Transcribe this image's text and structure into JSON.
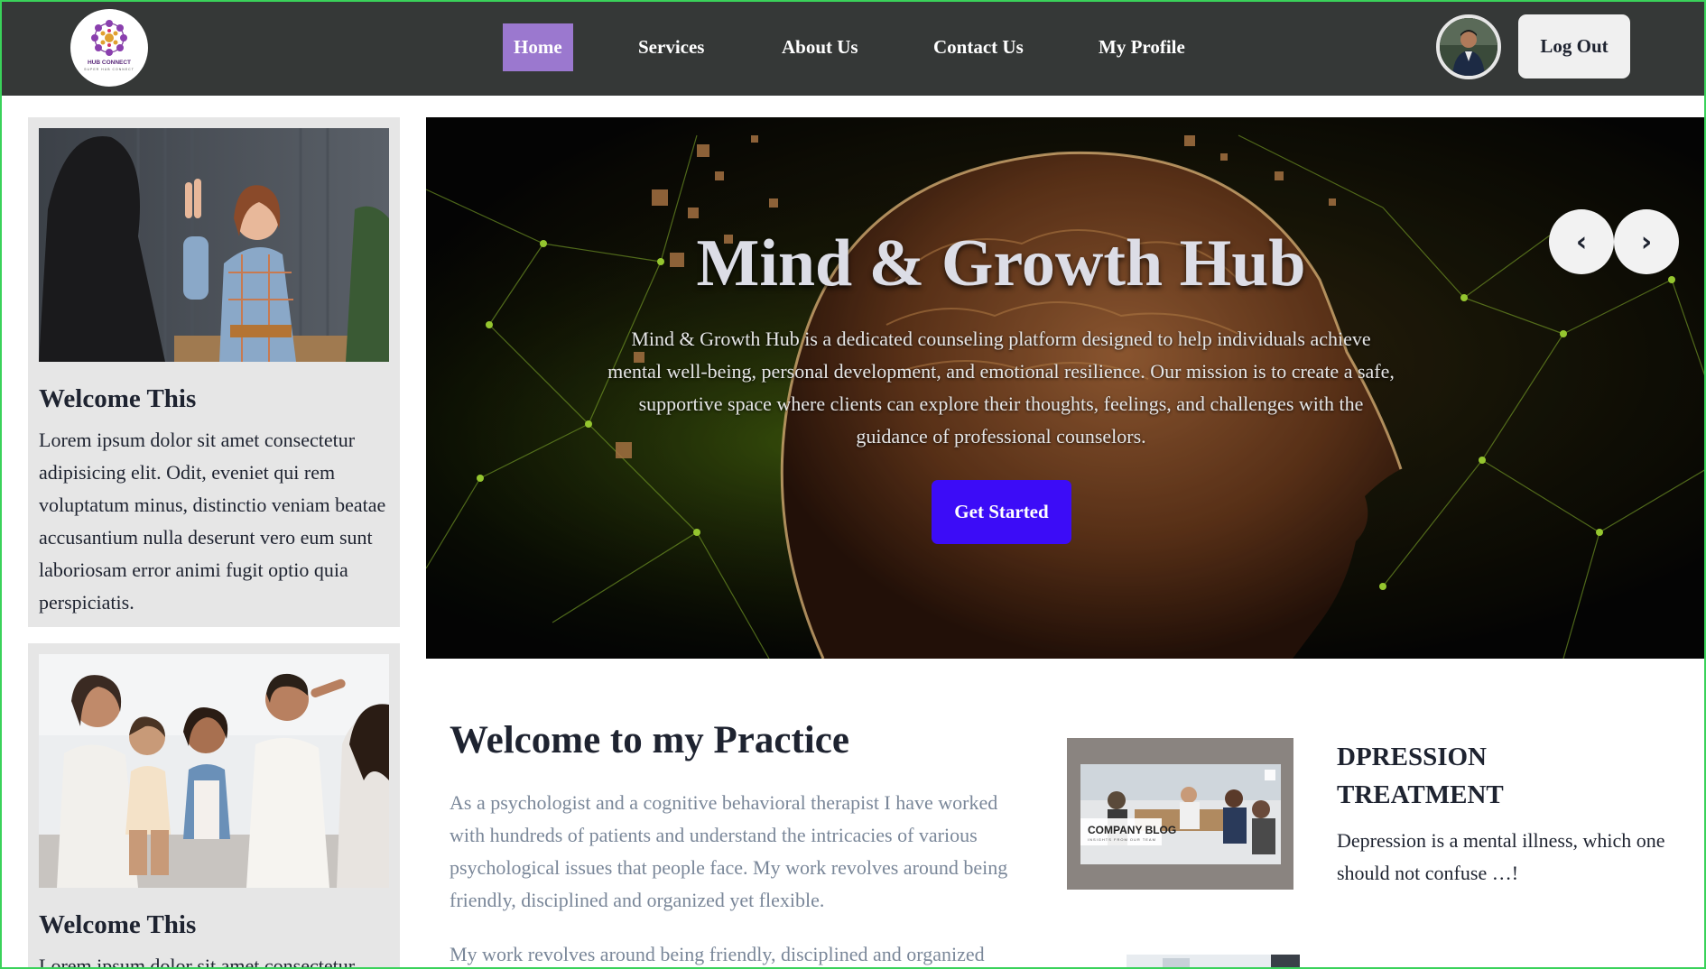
{
  "navbar": {
    "logo_text": "HUB CONNECT",
    "logo_subtext": "SUPER HUB CONNECT",
    "links": [
      {
        "label": "Home",
        "active": true
      },
      {
        "label": "Services",
        "active": false
      },
      {
        "label": "About Us",
        "active": false
      },
      {
        "label": "Contact Us",
        "active": false
      },
      {
        "label": "My Profile",
        "active": false
      }
    ],
    "logout_label": "Log Out"
  },
  "sidebar": {
    "cards": [
      {
        "title": "Welcome This",
        "text": "Lorem ipsum dolor sit amet consectetur adipisicing elit. Odit, eveniet qui rem voluptatum minus, distinctio veniam beatae accusantium nulla deserunt vero eum sunt laboriosam error animi fugit optio quia perspiciatis."
      },
      {
        "title": "Welcome This",
        "text": "Lorem ipsum dolor sit amet consectetur"
      }
    ]
  },
  "hero": {
    "title": "Mind & Growth Hub",
    "text": "Mind & Growth Hub is a dedicated counseling platform designed to help individuals achieve mental well-being, personal development, and emotional resilience. Our mission is to create a safe, supportive space where clients can explore their thoughts, feelings, and challenges with the guidance of professional counselors.",
    "button_label": "Get Started",
    "prev_label": "‹",
    "next_label": "›"
  },
  "practice": {
    "title": "Welcome to my Practice",
    "paragraph1": "As a psychologist and a cognitive behavioral therapist I have worked with hundreds of patients and understand the intricacies of various psychological issues that people face. My work revolves around being friendly, disciplined and organized yet flexible.",
    "paragraph2": "My work revolves around being friendly, disciplined and organized"
  },
  "article": {
    "thumb_label": "COMPANY BLOG",
    "thumb_sublabel": "INSIGHTS FROM OUR TEAM",
    "title": "DPRESSION TREATMENT",
    "text": "Depression is a mental illness, which one should not confuse …!"
  },
  "colors": {
    "navbar_bg": "#353837",
    "nav_active_bg": "#9b78cf",
    "card_bg": "#e6e6e6",
    "hero_button": "#3c0cf7",
    "muted_text": "#7a8799",
    "frame_border": "#3ad25a"
  }
}
